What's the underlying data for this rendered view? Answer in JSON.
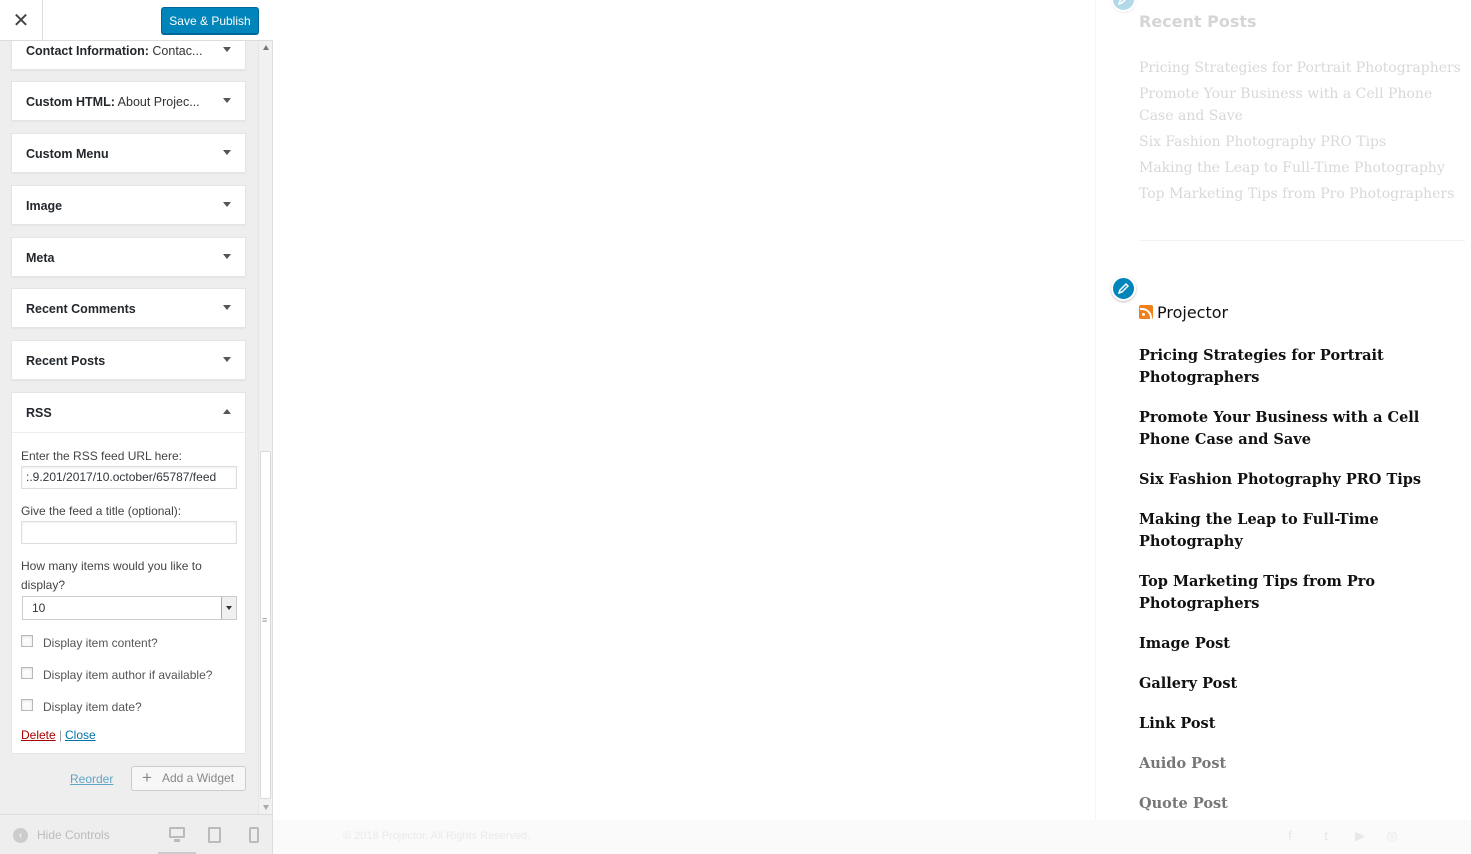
{
  "topbar": {
    "close_glyph": "✕",
    "save_label": "Save & Publish"
  },
  "widgets": [
    {
      "title": "Contact Information:",
      "subtitle": " Contac..."
    },
    {
      "title": "Custom HTML:",
      "subtitle": " About Projec..."
    },
    {
      "title": "Custom Menu",
      "subtitle": ""
    },
    {
      "title": "Image",
      "subtitle": ""
    },
    {
      "title": "Meta",
      "subtitle": ""
    },
    {
      "title": "Recent Comments",
      "subtitle": ""
    },
    {
      "title": "Recent Posts",
      "subtitle": ""
    }
  ],
  "rss_widget": {
    "title": "RSS",
    "url_label": "Enter the RSS feed URL here:",
    "url_value": ":.9.201/2017/10.october/65787/feed",
    "title_label": "Give the feed a title (optional):",
    "title_value": "",
    "items_label": "How many items would you like to display?",
    "items_value": "10",
    "checkboxes": [
      {
        "label": "Display item content?",
        "checked": false
      },
      {
        "label": "Display item author if available?",
        "checked": false
      },
      {
        "label": "Display item date?",
        "checked": false
      }
    ],
    "delete_label": "Delete",
    "separator": "|",
    "close_label": "Close"
  },
  "actions": {
    "reorder_label": "Reorder",
    "add_widget_label": "Add a Widget",
    "add_glyph": "+"
  },
  "footer_controls": {
    "hide_label": "Hide Controls",
    "hide_glyph": "‹",
    "devices": [
      "desktop-icon",
      "tablet-icon",
      "mobile-icon"
    ]
  },
  "preview": {
    "recent_posts": {
      "title": "Recent Posts",
      "items": [
        "Pricing Strategies for Portrait Photographers",
        "Promote Your Business with a Cell Phone Case and Save",
        "Six Fashion Photography PRO Tips",
        "Making the Leap to Full-Time Photography",
        "Top Marketing Tips from Pro Photographers"
      ]
    },
    "rss_feed": {
      "title": "Projector",
      "items": [
        "Pricing Strategies for Portrait Photographers",
        "Promote Your Business with a Cell Phone Case and Save",
        "Six Fashion Photography PRO Tips",
        "Making the Leap to Full-Time Photography",
        "Top Marketing Tips from Pro Photographers",
        "Image Post",
        "Gallery Post",
        "Link Post",
        "Auido Post",
        "Quote Post"
      ]
    },
    "footer": {
      "copyright": "© 2018 Projector. All Rights Reserved."
    },
    "social_icons": [
      "facebook-icon",
      "twitter-icon",
      "youtube-icon",
      "instagram-icon"
    ]
  },
  "colors": {
    "primary": "#0085ba",
    "delete": "#a00000",
    "link": "#0073aa",
    "rss_orange": "#f27f1b"
  }
}
